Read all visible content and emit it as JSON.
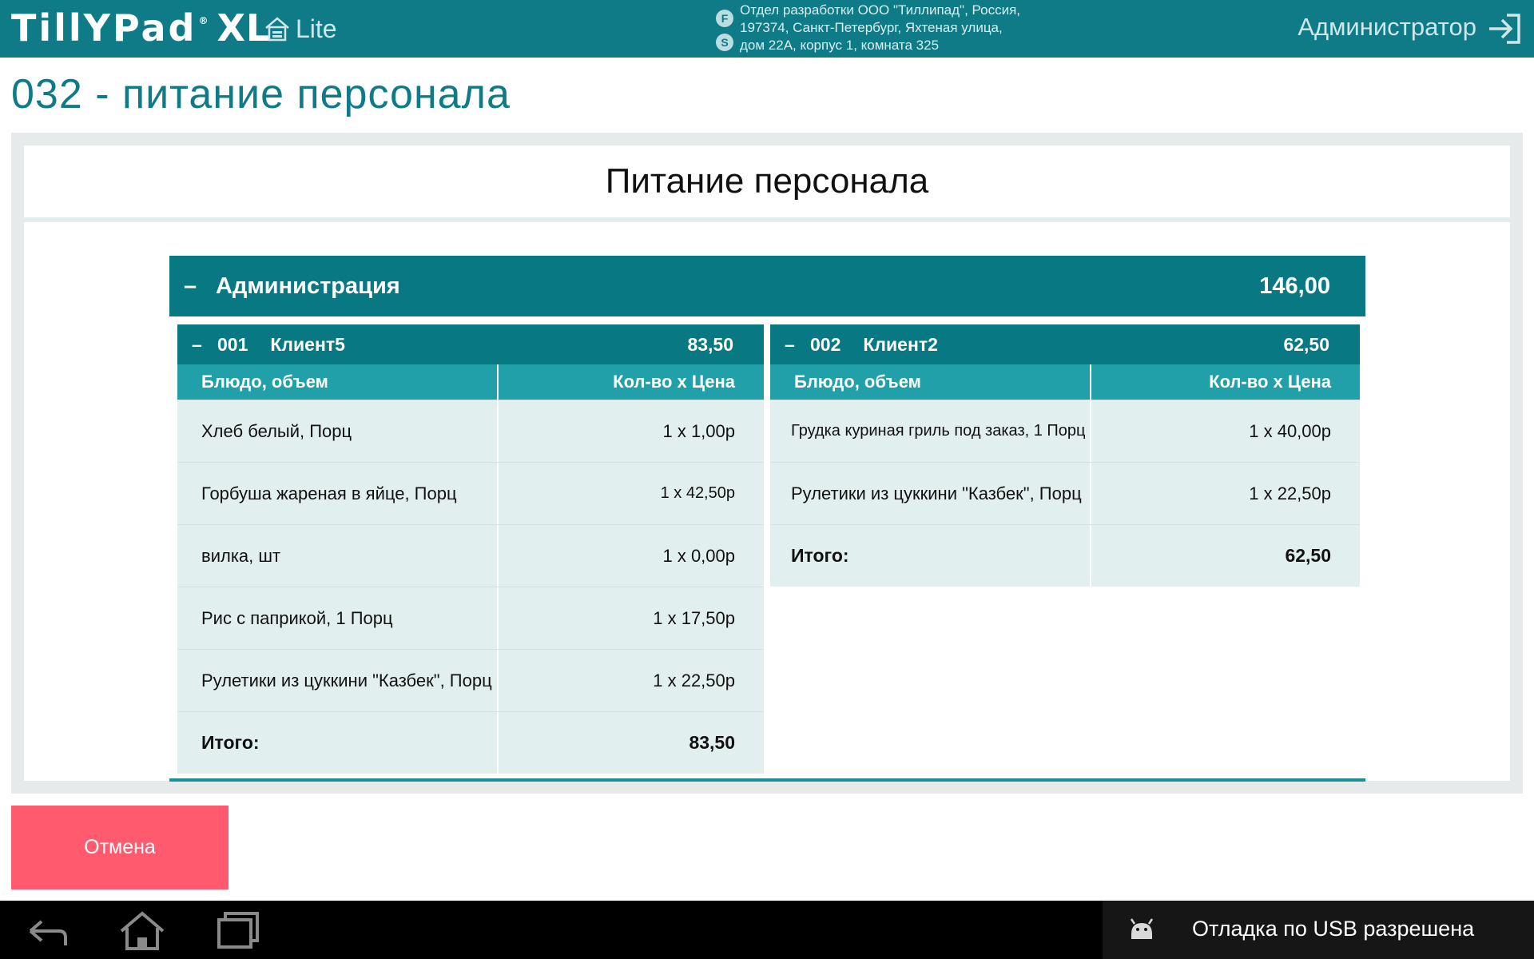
{
  "header": {
    "logo_main": "TillYPad",
    "logo_reg": "®",
    "logo_xl": "XL",
    "edition": "Lite",
    "org_badges": [
      "F",
      "S"
    ],
    "org_lines": [
      "Отдел разработки ООО \"Тиллипад\", Россия,",
      "197374, Санкт-Петербург, Яхтеная улица,",
      "дом 22А, корпус 1, комната 325"
    ],
    "user": "Администратор",
    "icons": {
      "home": "home-outline-icon",
      "logout": "logout-arrow-icon"
    },
    "colors": {
      "bar": "#0e7b86"
    }
  },
  "page": {
    "title": "032 - питание персонала"
  },
  "panel": {
    "title": "Питание персонала",
    "group": {
      "toggle": "–",
      "name": "Администрация",
      "total": "146,00"
    },
    "columns": {
      "dish": "Блюдо, объем",
      "qty_price": "Кол-во х Цена"
    },
    "clients": [
      {
        "toggle": "–",
        "code": "001",
        "name": "Клиент5",
        "sum": "83,50",
        "rows": [
          {
            "dish": "Хлеб белый, Порц",
            "qty_price": "1 x 1,00р"
          },
          {
            "dish": "Горбуша жареная в яйце, Порц",
            "qty_price": "1 x 42,50р"
          },
          {
            "dish": "вилка, шт",
            "qty_price": "1 x 0,00р"
          },
          {
            "dish": "Рис с паприкой, 1 Порц",
            "qty_price": "1 x 17,50р"
          },
          {
            "dish": "Рулетики из цуккини \"Казбек\", Порц",
            "qty_price": "1 x 22,50р"
          }
        ],
        "total_label": "Итого:",
        "total": "83,50"
      },
      {
        "toggle": "–",
        "code": "002",
        "name": "Клиент2",
        "sum": "62,50",
        "rows": [
          {
            "dish": "Грудка куриная гриль под заказ, 1 Порц",
            "qty_price": "1 x 40,00р"
          },
          {
            "dish": "Рулетики из цуккини \"Казбек\", Порц",
            "qty_price": "1 x 22,50р"
          }
        ],
        "total_label": "Итого:",
        "total": "62,50"
      }
    ]
  },
  "actions": {
    "cancel": "Отмена",
    "cancel_color": "#ff5a6e"
  },
  "system_bar": {
    "back_icon": "back-arrow-icon",
    "home_icon": "home-icon",
    "recent_icon": "recent-apps-icon",
    "debug_icon": "android-debug-icon",
    "notification": "Отладка по USB разрешена"
  }
}
